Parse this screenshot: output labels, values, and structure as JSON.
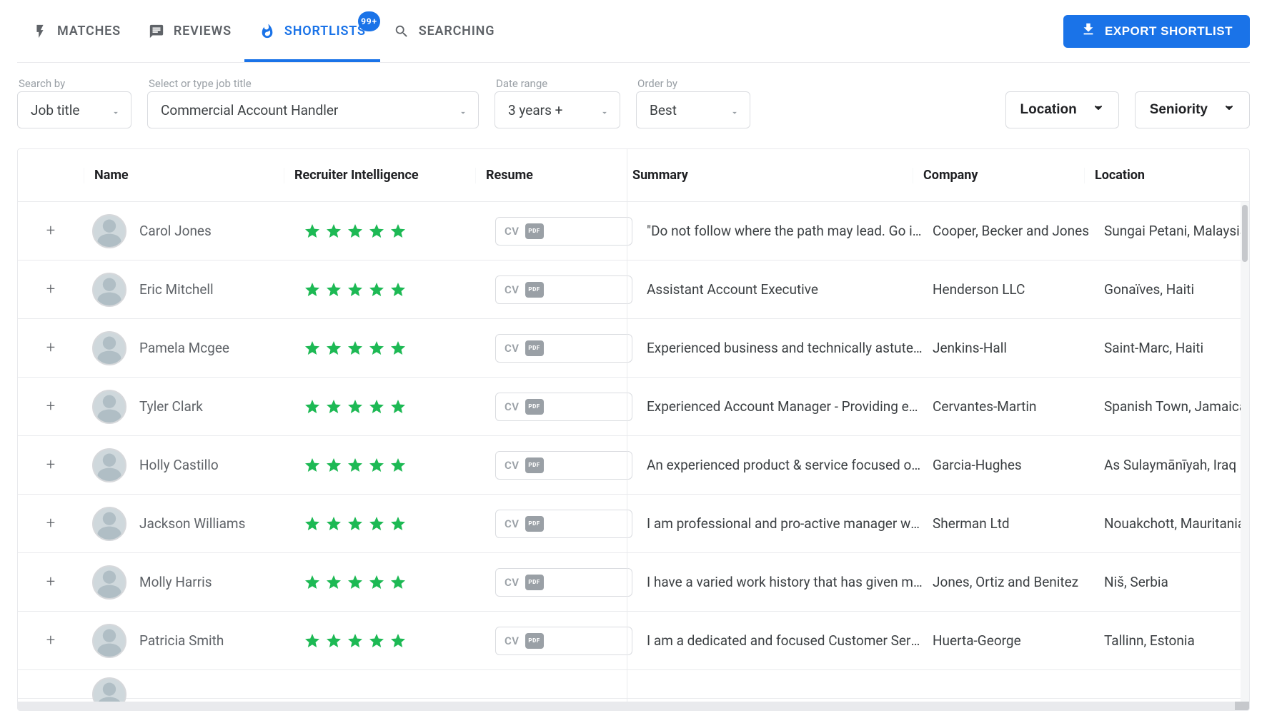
{
  "nav": {
    "tabs": [
      {
        "id": "matches",
        "label": "MATCHES",
        "icon": "bolt"
      },
      {
        "id": "reviews",
        "label": "REVIEWS",
        "icon": "comment"
      },
      {
        "id": "shortlists",
        "label": "SHORTLISTS",
        "icon": "fire",
        "active": true,
        "badge": "99+"
      },
      {
        "id": "searching",
        "label": "SEARCHING",
        "icon": "search"
      }
    ],
    "export_label": "EXPORT SHORTLIST"
  },
  "filters": {
    "search_by": {
      "label": "Search by",
      "value": "Job title"
    },
    "job_title": {
      "label": "Select or type job title",
      "value": "Commercial Account Handler"
    },
    "date_range": {
      "label": "Date range",
      "value": "3 years +"
    },
    "order_by": {
      "label": "Order by",
      "value": "Best"
    },
    "location_btn": "Location",
    "seniority_btn": "Seniority"
  },
  "table": {
    "headers": {
      "name": "Name",
      "intel": "Recruiter Intelligence",
      "resume": "Resume",
      "summary": "Summary",
      "company": "Company",
      "location": "Location"
    },
    "cv_label": "CV",
    "rows": [
      {
        "name": "Carol Jones",
        "stars": 5,
        "summary": "\"Do not follow where the path may lead. Go inst…",
        "company": "Cooper, Becker and Jones",
        "location": "Sungai Petani, Malaysia"
      },
      {
        "name": "Eric Mitchell",
        "stars": 5,
        "summary": "Assistant Account Executive",
        "company": "Henderson LLC",
        "location": "Gonaïves, Haiti"
      },
      {
        "name": "Pamela Mcgee",
        "stars": 5,
        "summary": "Experienced business and technically astute pro…",
        "company": "Jenkins-Hall",
        "location": "Saint-Marc, Haiti"
      },
      {
        "name": "Tyler Clark",
        "stars": 5,
        "summary": "Experienced Account Manager - Providing excell…",
        "company": "Cervantes-Martin",
        "location": "Spanish Town, Jamaica"
      },
      {
        "name": "Holly Castillo",
        "stars": 5,
        "summary": "An experienced product & service focused oper…",
        "company": "Garcia-Hughes",
        "location": "As Sulaymānīyah, Iraq"
      },
      {
        "name": "Jackson Williams",
        "stars": 5,
        "summary": "I am professional and pro-active manager who a…",
        "company": "Sherman Ltd",
        "location": "Nouakchott, Mauritania"
      },
      {
        "name": "Molly Harris",
        "stars": 5,
        "summary": "I have a varied work history that has given me a …",
        "company": "Jones, Ortiz and Benitez",
        "location": "Niš, Serbia"
      },
      {
        "name": "Patricia Smith",
        "stars": 5,
        "summary": "I am a dedicated and focused Customer Service…",
        "company": "Huerta-George",
        "location": "Tallinn, Estonia"
      }
    ]
  }
}
